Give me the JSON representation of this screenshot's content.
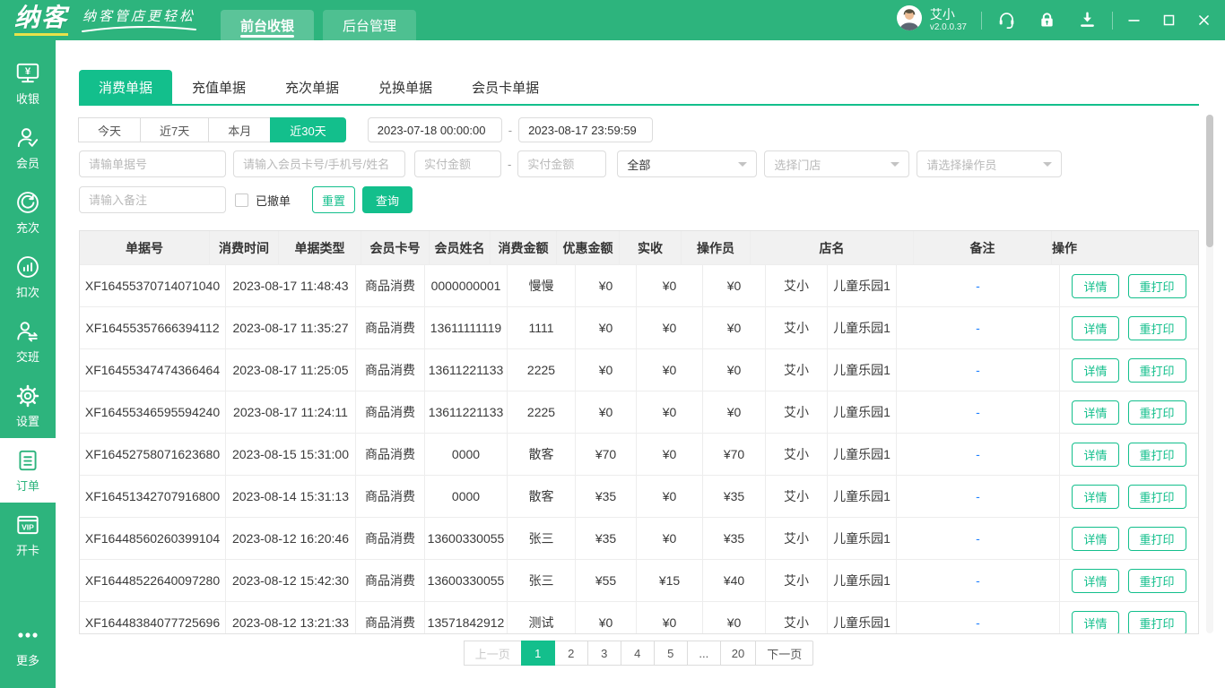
{
  "topbar": {
    "logo": "纳客",
    "slogan": "纳客管店更轻松",
    "nav_tabs": [
      {
        "label": "前台收银",
        "active": true
      },
      {
        "label": "后台管理"
      }
    ],
    "user": {
      "name": "艾小",
      "version": "v2.0.0.37",
      "avatar_icon": "avatar"
    },
    "tool_icons": [
      {
        "name": "customer-service-icon"
      },
      {
        "name": "lock-icon"
      },
      {
        "name": "download-icon"
      }
    ],
    "window_controls": [
      {
        "name": "minimize-icon"
      },
      {
        "name": "maximize-icon"
      },
      {
        "name": "close-icon"
      }
    ]
  },
  "sidebar": {
    "items": [
      {
        "label": "收银",
        "icon": "cashier-icon"
      },
      {
        "label": "会员",
        "icon": "member-icon"
      },
      {
        "label": "充次",
        "icon": "recharge-times-icon"
      },
      {
        "label": "扣次",
        "icon": "deduct-times-icon"
      },
      {
        "label": "交班",
        "icon": "shift-handover-icon"
      },
      {
        "label": "设置",
        "icon": "settings-gear-icon"
      },
      {
        "label": "订单",
        "icon": "orders-icon",
        "active": true
      },
      {
        "label": "开卡",
        "icon": "vip-card-icon"
      },
      {
        "label": "更多",
        "icon": "more-dots-icon"
      }
    ]
  },
  "page_tabs": [
    {
      "label": "消费单据",
      "active": true
    },
    {
      "label": "充值单据"
    },
    {
      "label": "充次单据"
    },
    {
      "label": "兑换单据"
    },
    {
      "label": "会员卡单据"
    }
  ],
  "filters": {
    "date_presets": [
      {
        "label": "今天"
      },
      {
        "label": "近7天"
      },
      {
        "label": "本月"
      },
      {
        "label": "近30天",
        "active": true
      }
    ],
    "date_from": "2023-07-18 00:00:00",
    "date_to": "2023-08-17 23:59:59",
    "range_separator": "-",
    "bill_no_placeholder": "请输单据号",
    "member_placeholder": "请输入会员卡号/手机号/姓名",
    "amount_min_placeholder": "实付金额",
    "amount_max_placeholder": "实付金额",
    "bill_type_value": "全部",
    "store_placeholder": "选择门店",
    "operator_placeholder": "请选择操作员",
    "remark_placeholder": "请输入备注",
    "cancelled_label": "已撤单",
    "reset_label": "重置",
    "search_label": "查询"
  },
  "table": {
    "columns": [
      "单据号",
      "消费时间",
      "单据类型",
      "会员卡号",
      "会员姓名",
      "消费金额",
      "优惠金额",
      "实收",
      "操作员",
      "店名",
      "备注",
      "操作"
    ],
    "rows": [
      {
        "bill_no": "XF16455370714071040",
        "time": "2023-08-17 11:48:43",
        "type": "商品消费",
        "card_no": "0000000001",
        "name": "慢慢",
        "amount": "¥0",
        "discount": "¥0",
        "paid": "¥0",
        "operator": "艾小",
        "store": "儿童乐园1",
        "remark": "-",
        "actions": [
          "详情",
          "重打印"
        ]
      },
      {
        "bill_no": "XF16455357666394112",
        "time": "2023-08-17 11:35:27",
        "type": "商品消费",
        "card_no": "13611111119",
        "name": "1111",
        "amount": "¥0",
        "discount": "¥0",
        "paid": "¥0",
        "operator": "艾小",
        "store": "儿童乐园1",
        "remark": "-",
        "actions": [
          "详情",
          "重打印"
        ]
      },
      {
        "bill_no": "XF16455347474366464",
        "time": "2023-08-17 11:25:05",
        "type": "商品消费",
        "card_no": "13611221133",
        "name": "2225",
        "amount": "¥0",
        "discount": "¥0",
        "paid": "¥0",
        "operator": "艾小",
        "store": "儿童乐园1",
        "remark": "-",
        "actions": [
          "详情",
          "重打印"
        ]
      },
      {
        "bill_no": "XF16455346595594240",
        "time": "2023-08-17 11:24:11",
        "type": "商品消费",
        "card_no": "13611221133",
        "name": "2225",
        "amount": "¥0",
        "discount": "¥0",
        "paid": "¥0",
        "operator": "艾小",
        "store": "儿童乐园1",
        "remark": "-",
        "actions": [
          "详情",
          "重打印"
        ]
      },
      {
        "bill_no": "XF16452758071623680",
        "time": "2023-08-15 15:31:00",
        "type": "商品消费",
        "card_no": "0000",
        "name": "散客",
        "amount": "¥70",
        "discount": "¥0",
        "paid": "¥70",
        "operator": "艾小",
        "store": "儿童乐园1",
        "remark": "-",
        "actions": [
          "详情",
          "重打印"
        ]
      },
      {
        "bill_no": "XF16451342707916800",
        "time": "2023-08-14 15:31:13",
        "type": "商品消费",
        "card_no": "0000",
        "name": "散客",
        "amount": "¥35",
        "discount": "¥0",
        "paid": "¥35",
        "operator": "艾小",
        "store": "儿童乐园1",
        "remark": "-",
        "actions": [
          "详情",
          "重打印"
        ]
      },
      {
        "bill_no": "XF16448560260399104",
        "time": "2023-08-12 16:20:46",
        "type": "商品消费",
        "card_no": "13600330055",
        "name": "张三",
        "amount": "¥35",
        "discount": "¥0",
        "paid": "¥35",
        "operator": "艾小",
        "store": "儿童乐园1",
        "remark": "-",
        "actions": [
          "详情",
          "重打印"
        ]
      },
      {
        "bill_no": "XF16448522640097280",
        "time": "2023-08-12 15:42:30",
        "type": "商品消费",
        "card_no": "13600330055",
        "name": "张三",
        "amount": "¥55",
        "discount": "¥15",
        "paid": "¥40",
        "operator": "艾小",
        "store": "儿童乐园1",
        "remark": "-",
        "actions": [
          "详情",
          "重打印"
        ]
      },
      {
        "bill_no": "XF16448384077725696",
        "time": "2023-08-12 13:21:33",
        "type": "商品消费",
        "card_no": "13571842912",
        "name": "测试",
        "amount": "¥0",
        "discount": "¥0",
        "paid": "¥0",
        "operator": "艾小",
        "store": "儿童乐园1",
        "remark": "-",
        "actions": [
          "详情",
          "重打印"
        ]
      }
    ]
  },
  "pagination": {
    "items": [
      {
        "label": "上一页",
        "disabled": true
      },
      {
        "label": "1",
        "active": true
      },
      {
        "label": "2"
      },
      {
        "label": "3"
      },
      {
        "label": "4"
      },
      {
        "label": "5"
      },
      {
        "label": "..."
      },
      {
        "label": "20"
      },
      {
        "label": "下一页"
      }
    ]
  },
  "colors": {
    "header_green": "#2db47d",
    "accent_green": "#13bf8c",
    "remark_link_blue": "#1e80ff",
    "logo_accent_yellow": "#e8e24a"
  }
}
